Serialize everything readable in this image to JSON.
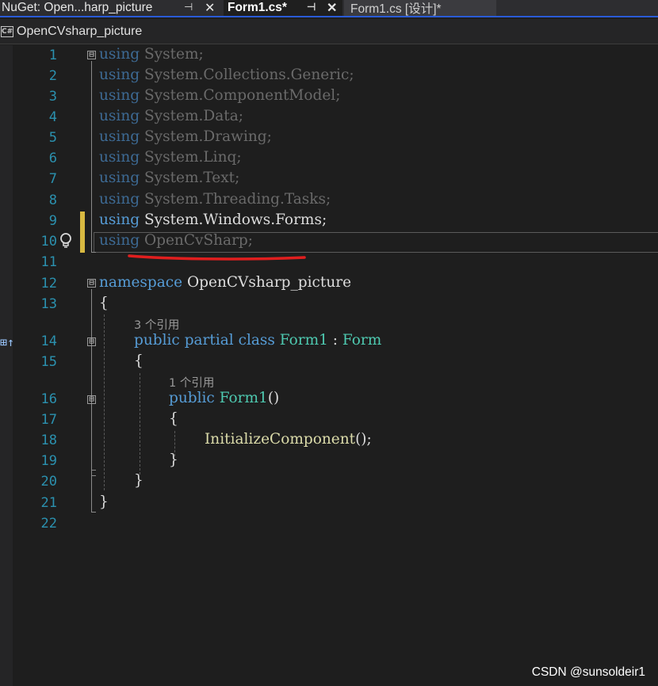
{
  "tabs": [
    {
      "label": "NuGet: Open...harp_picture",
      "pin": "⊣",
      "close": "✕"
    },
    {
      "label": "Form1.cs*",
      "pin": "⊣",
      "close": "✕"
    },
    {
      "label": "Form1.cs [设计]*"
    }
  ],
  "file_header": {
    "icon": "C#",
    "name": "OpenCVsharp_picture"
  },
  "line_numbers": [
    "1",
    "2",
    "3",
    "4",
    "5",
    "6",
    "7",
    "8",
    "9",
    "10",
    "11",
    "12",
    "13",
    "14",
    "15",
    "16",
    "17",
    "18",
    "19",
    "20",
    "21",
    "22"
  ],
  "code": {
    "kw_using": "using",
    "l1": " System;",
    "l2": " System.Collections.Generic;",
    "l3": " System.ComponentModel;",
    "l4": " System.Data;",
    "l5": " System.Drawing;",
    "l6": " System.Linq;",
    "l7": " System.Text;",
    "l8": " System.Threading.Tasks;",
    "l9": " System.Windows.Forms;",
    "l10": " OpenCvSharp;",
    "kw_namespace": "namespace",
    "namespace_name": " OpenCVsharp_picture",
    "open_brace": "{",
    "close_brace": "}",
    "kw_public": "public",
    "kw_partial": "partial",
    "kw_class": "class",
    "class_name": "Form1",
    "colon": " : ",
    "base_type": "Form",
    "ctor_name": "Form1",
    "parens": "()",
    "init_call": "InitializeComponent",
    "init_tail": "();"
  },
  "codelens": {
    "class_refs": "3 个引用",
    "ctor_refs": "1 个引用"
  },
  "fold_glyph": "⊟",
  "side_glyph": "⊞↑",
  "watermark": "CSDN @sunsoldeir1",
  "colors": {
    "keyword": "#569cd6",
    "type": "#4ec9b0",
    "method": "#dcdcaa",
    "line_number": "#2b91af",
    "change_marker": "#d8b941",
    "annotation": "#e01e1e"
  }
}
